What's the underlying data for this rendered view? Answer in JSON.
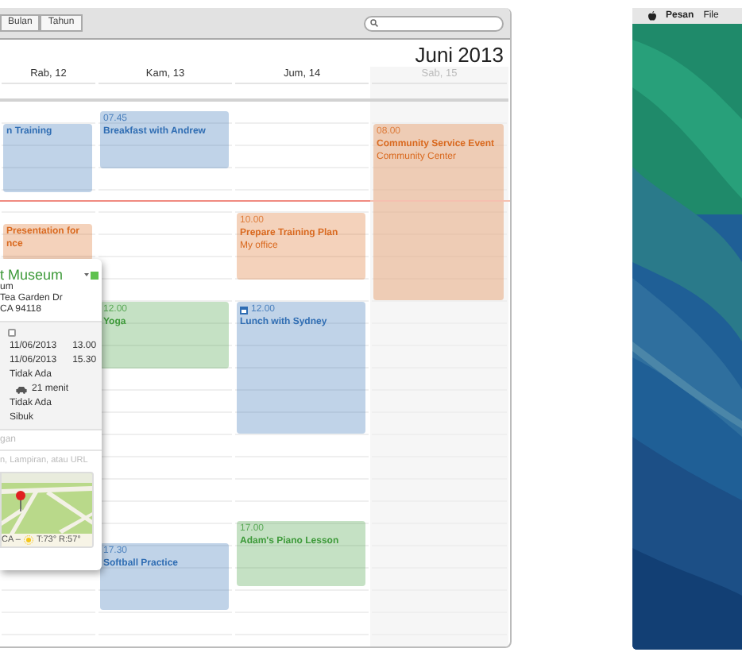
{
  "toolbar": {
    "view_buttons": [
      {
        "label": "Bulan",
        "selected": false
      },
      {
        "label": "Tahun",
        "selected": false
      }
    ]
  },
  "header": {
    "month": "Juni",
    "year": "2013"
  },
  "days": [
    {
      "label": "Rab, 12",
      "weekend": false,
      "events": [
        {
          "title_lines": [
            "n Training"
          ],
          "color": "#2f6db3"
        },
        {
          "title_lines": [
            "Presentation for",
            "nce"
          ],
          "color": "#d9691f"
        }
      ]
    },
    {
      "label": "Kam, 13",
      "weekend": false,
      "events": [
        {
          "time": "07.45",
          "title_lines": [
            "Breakfast with Andrew"
          ],
          "color": "#2f6db3",
          "shared": false
        },
        {
          "time": "12.00",
          "title_lines": [
            "Yoga"
          ],
          "color": "#3e9a3a",
          "shared": false
        },
        {
          "time": "17.30",
          "title_lines": [
            "Softball Practice"
          ],
          "color": "#2f6db3",
          "shared": false
        }
      ]
    },
    {
      "label": "Jum, 14",
      "weekend": false,
      "events": [
        {
          "time": "10.00",
          "title_lines": [
            "Prepare Training Plan"
          ],
          "location": "My office",
          "color": "#d9691f",
          "shared": false
        },
        {
          "time": "12.00",
          "title_lines": [
            "Lunch with Sydney"
          ],
          "color": "#2f6db3",
          "shared": true
        },
        {
          "time": "17.00",
          "title_lines": [
            "Adam's Piano Lesson"
          ],
          "color": "#3e9a3a",
          "shared": false
        }
      ]
    },
    {
      "label": "Sab, 15",
      "weekend": true,
      "events": [
        {
          "time": "08.00",
          "title_lines": [
            "Community Service Event"
          ],
          "location": "Community Center",
          "color": "#d9691f",
          "shared": false
        }
      ]
    }
  ],
  "popover": {
    "title": "t Museum",
    "address_lines": [
      "um",
      "Tea Garden Dr",
      "CA 94118"
    ],
    "rows": [
      {
        "kind": "checkbox",
        "checked": false
      },
      {
        "kind": "datetime",
        "date": "11/06/2013",
        "time": "13.00"
      },
      {
        "kind": "datetime",
        "date": "11/06/2013",
        "time": "15.30"
      },
      {
        "kind": "text",
        "value": "Tidak Ada"
      },
      {
        "kind": "travel",
        "value": "21 menit"
      },
      {
        "kind": "text",
        "value": "Tidak Ada"
      },
      {
        "kind": "text",
        "value": "Sibuk"
      }
    ],
    "invitees_placeholder": "gan",
    "notes_placeholder": "n, Lampiran, atau URL",
    "weather": {
      "place": "CA –",
      "reading": "T:73° R:57°"
    }
  },
  "desktop": {
    "menu": [
      {
        "label": "Pesan",
        "bold": true
      },
      {
        "label": "File",
        "bold": false
      }
    ]
  }
}
